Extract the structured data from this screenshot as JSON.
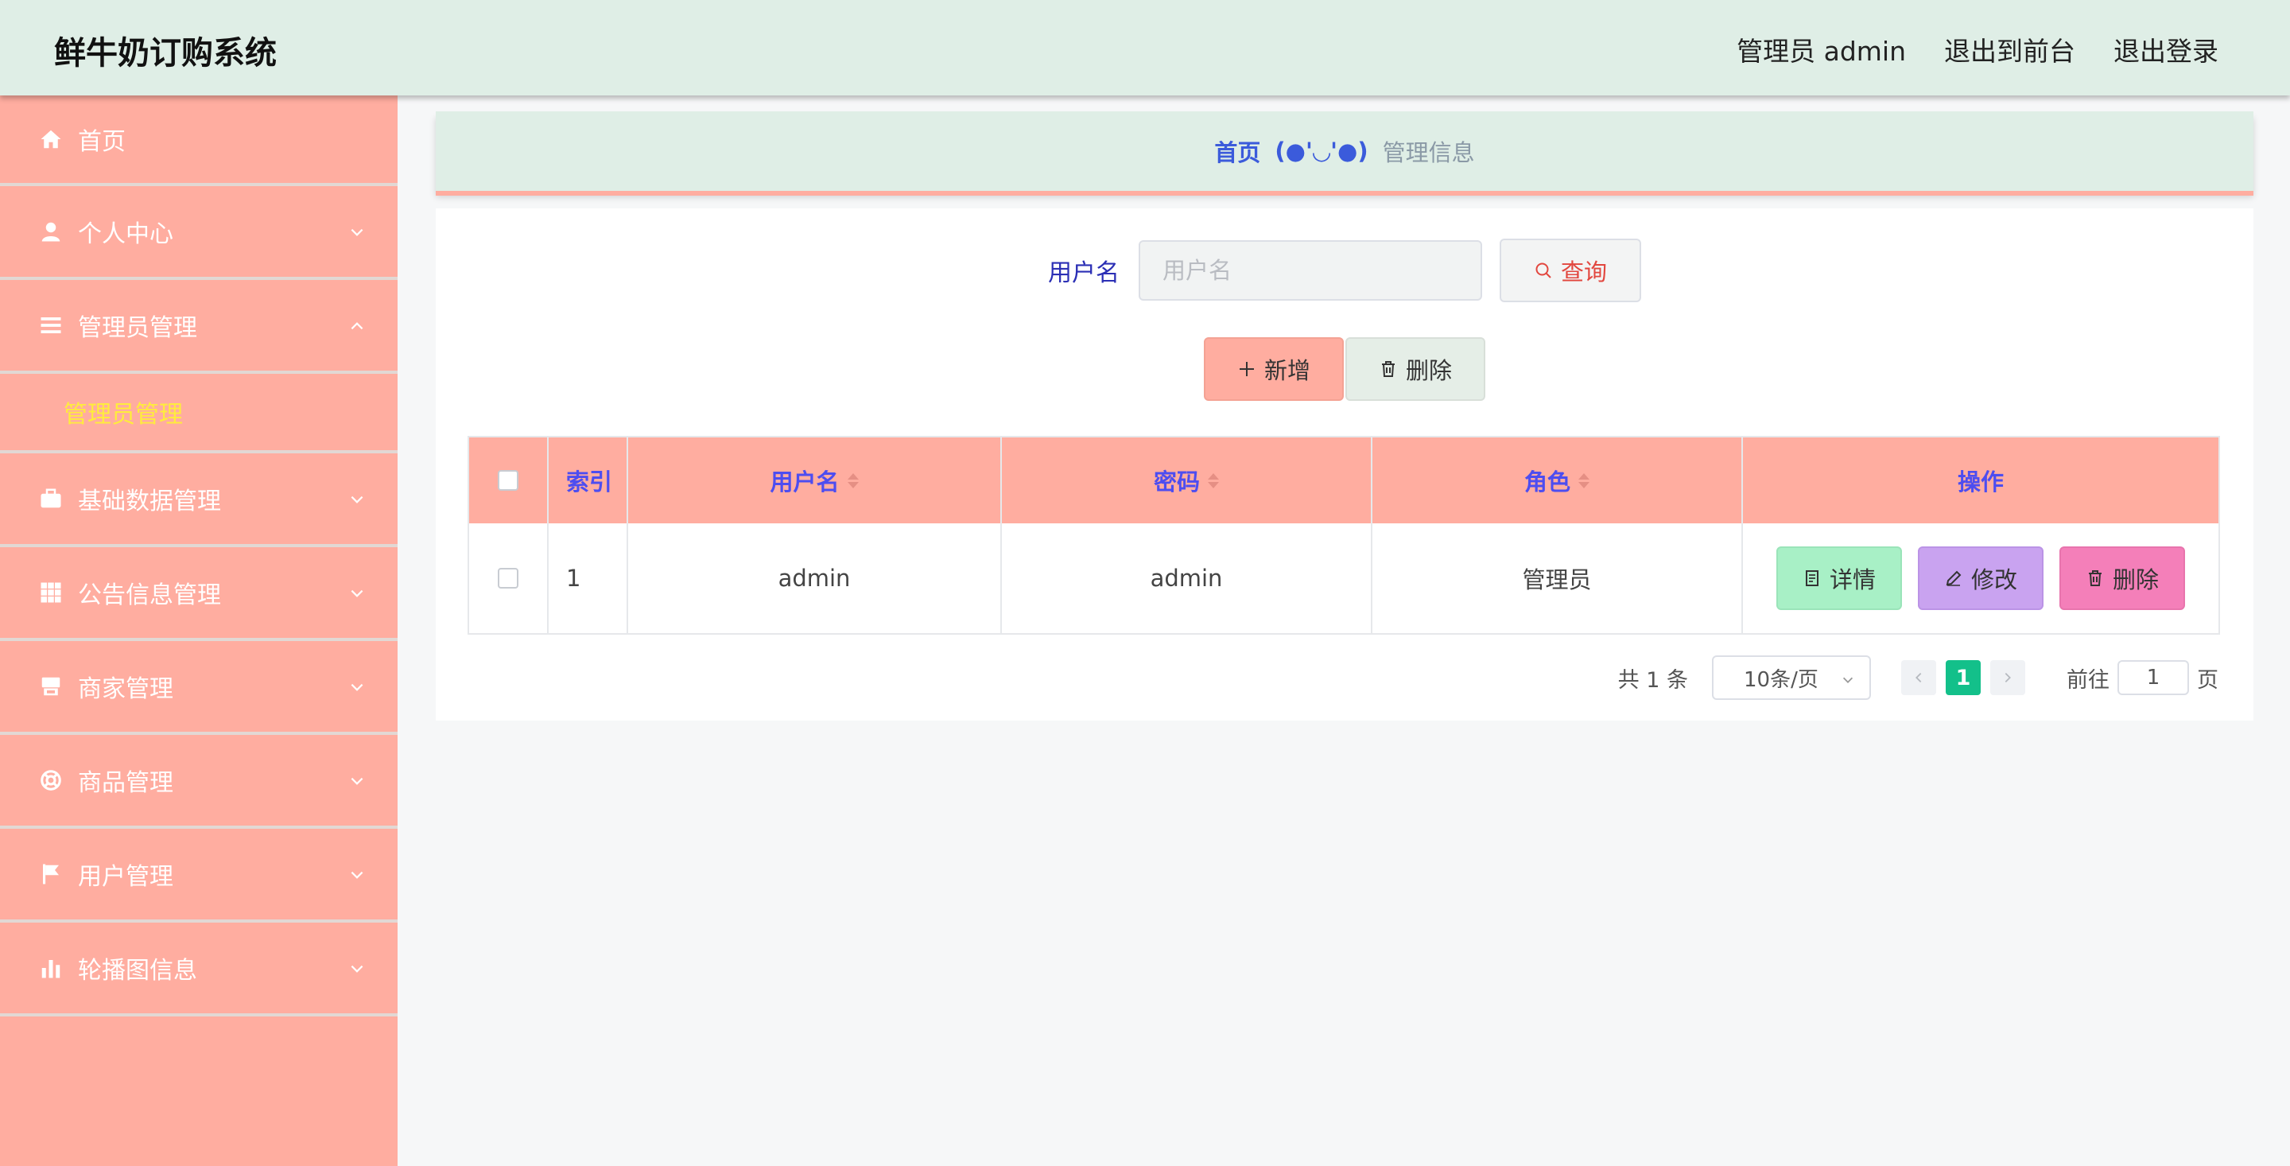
{
  "header": {
    "title": "鲜牛奶订购系统",
    "admin_label": "管理员 admin",
    "exit_front": "退出到前台",
    "logout": "退出登录"
  },
  "sidebar": {
    "items": [
      {
        "label": "首页",
        "icon": "home-icon"
      },
      {
        "label": "个人中心",
        "icon": "user-icon"
      },
      {
        "label": "管理员管理",
        "icon": "list-icon",
        "expanded": true,
        "children": [
          "管理员管理"
        ]
      },
      {
        "label": "基础数据管理",
        "icon": "briefcase-icon"
      },
      {
        "label": "公告信息管理",
        "icon": "grid-icon"
      },
      {
        "label": "商家管理",
        "icon": "shop-icon"
      },
      {
        "label": "商品管理",
        "icon": "lifebuoy-icon"
      },
      {
        "label": "用户管理",
        "icon": "flag-icon"
      },
      {
        "label": "轮播图信息",
        "icon": "bar-chart-icon"
      }
    ]
  },
  "breadcrumb": {
    "home": "首页",
    "separator": "(●'◡'●)",
    "current": "管理信息"
  },
  "search": {
    "label": "用户名",
    "placeholder": "用户名",
    "query_button": "查询"
  },
  "actions": {
    "add": "新增",
    "delete": "删除"
  },
  "table": {
    "headers": [
      "索引",
      "用户名",
      "密码",
      "角色",
      "操作"
    ],
    "rows": [
      {
        "index": "1",
        "username": "admin",
        "password": "admin",
        "role": "管理员"
      }
    ],
    "row_actions": {
      "detail": "详情",
      "edit": "修改",
      "delete": "删除"
    }
  },
  "pagination": {
    "total": "共 1 条",
    "page_size": "10条/页",
    "current_page": "1",
    "goto_label": "前往",
    "goto_value": "1",
    "page_suffix": "页"
  },
  "colors": {
    "sidebar": "#ffada0",
    "header": "#dfeee6",
    "accent_blue": "#4d4df0",
    "active_page": "#13c08a",
    "submenu_active": "#ffec3d"
  }
}
